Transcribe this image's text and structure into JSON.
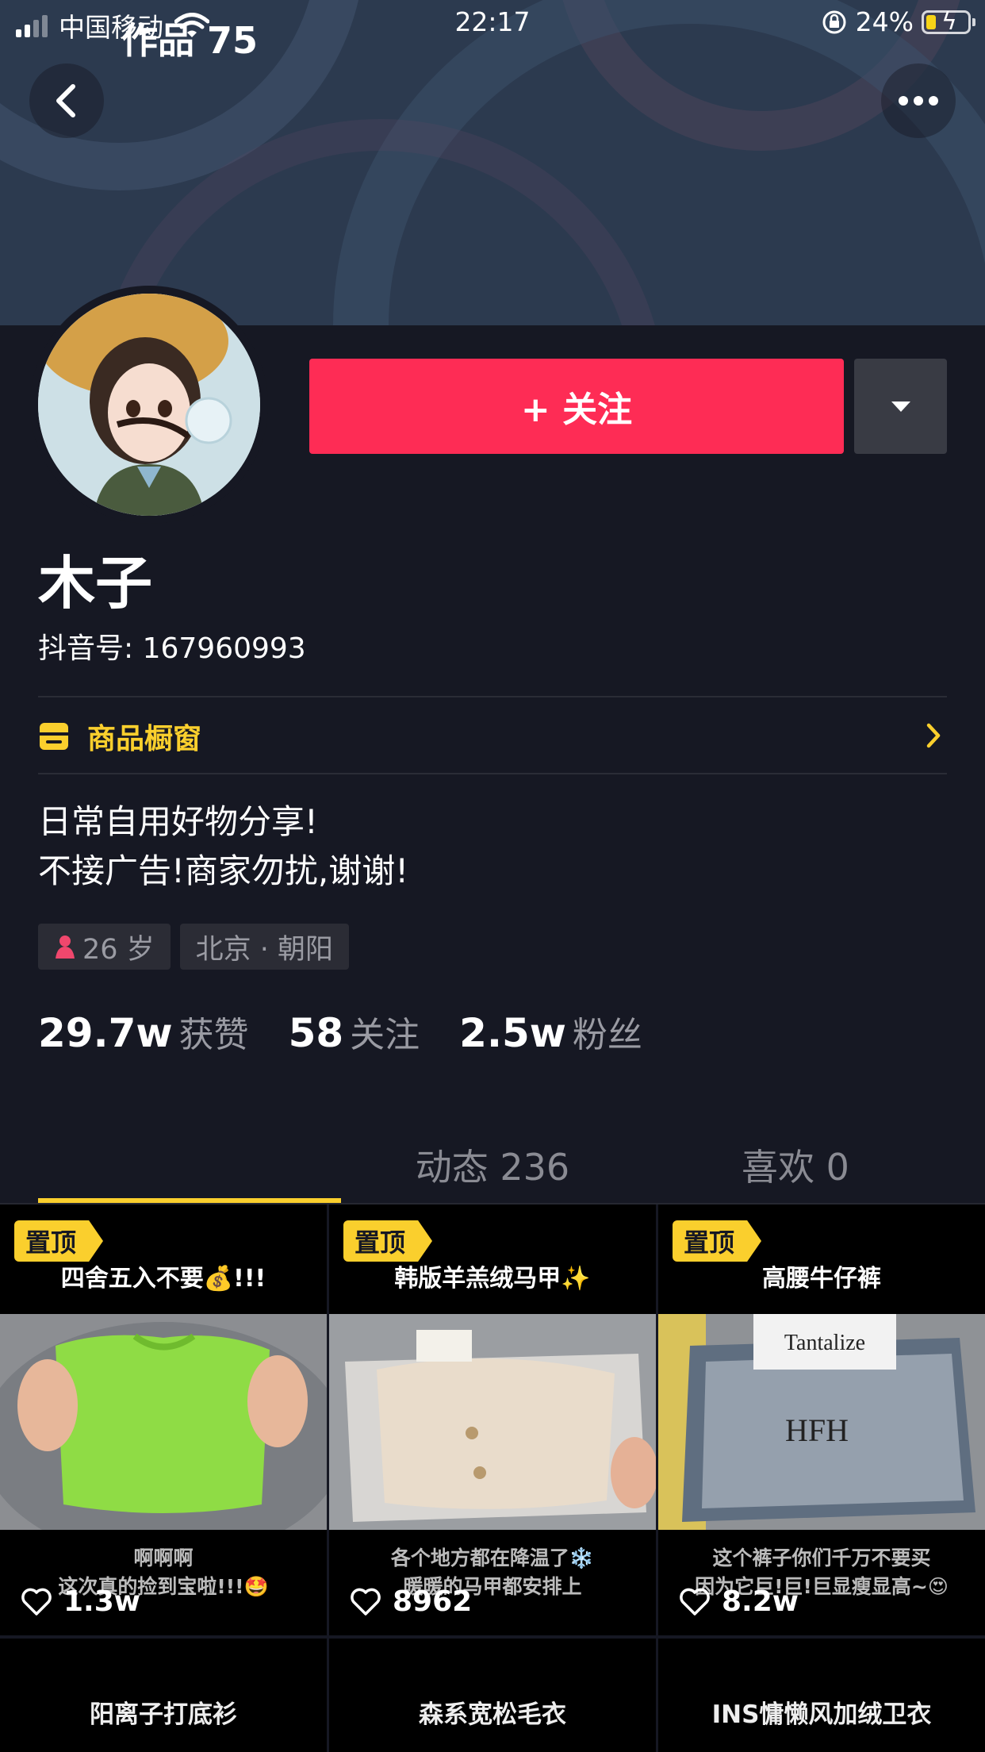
{
  "status_bar": {
    "carrier": "中国移动",
    "time": "22:17",
    "battery": "24%"
  },
  "header": {
    "back_icon": "chevron-left-icon",
    "more_icon": "ellipsis-icon"
  },
  "profile": {
    "follow_label": "+ 关注",
    "name": "木子",
    "douyin_id": "抖音号: 167960993",
    "shop_label": "商品橱窗",
    "bio_lines": [
      "日常自用好物分享!",
      "不接广告!商家勿扰,谢谢!"
    ],
    "tags": {
      "age": "26 岁",
      "location": "北京 · 朝阳"
    },
    "stats": {
      "likes": {
        "num": "29.7w",
        "label": "获赞"
      },
      "following": {
        "num": "58",
        "label": "关注"
      },
      "followers": {
        "num": "2.5w",
        "label": "粉丝"
      }
    }
  },
  "tabs": [
    {
      "label": "作品 75"
    },
    {
      "label": "动态 236"
    },
    {
      "label": "喜欢 0"
    }
  ],
  "videos": [
    {
      "pin": "置顶",
      "top": "四舍五入不要💰!!!",
      "bottom_1": "啊啊啊",
      "bottom_2": "这次真的捡到宝啦!!!🤩",
      "likes": "1.3w"
    },
    {
      "pin": "置顶",
      "top": "韩版羊羔绒马甲✨",
      "bottom_1": "各个地方都在降温了❄️",
      "bottom_2": "暖暖的马甲都安排上",
      "likes": "8962"
    },
    {
      "pin": "置顶",
      "top": "高腰牛仔裤",
      "bottom_1": "这个裤子你们千万不要买",
      "bottom_2": "因为它巨!巨!巨显瘦显高~😍",
      "likes": "8.2w"
    }
  ],
  "videos_row2": [
    {
      "title": "阳离子打底衫"
    },
    {
      "title": "森系宽松毛衣"
    },
    {
      "title": "INS慵懒风加绒卫衣"
    }
  ],
  "colors": {
    "background": "#161823",
    "follow_button": "#fe2c55",
    "accent_yellow": "#facf2d"
  }
}
